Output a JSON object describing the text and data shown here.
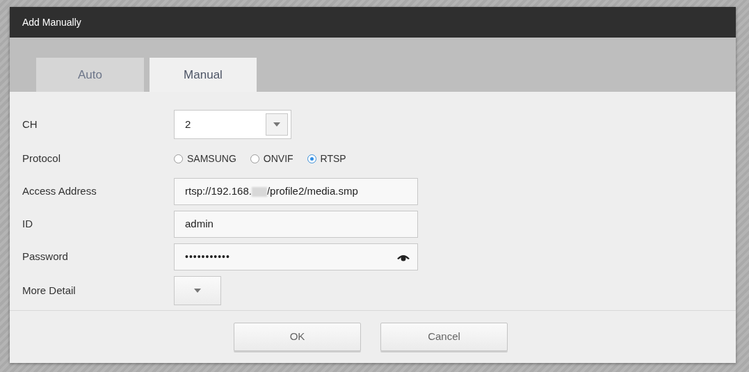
{
  "window": {
    "title": "Add Manually"
  },
  "tabs": [
    {
      "label": "Auto",
      "selected": false
    },
    {
      "label": "Manual",
      "selected": true
    }
  ],
  "form": {
    "ch": {
      "label": "CH",
      "value": "2"
    },
    "protocol": {
      "label": "Protocol",
      "options": [
        {
          "label": "SAMSUNG",
          "selected": false
        },
        {
          "label": "ONVIF",
          "selected": false
        },
        {
          "label": "RTSP",
          "selected": true
        }
      ]
    },
    "access_address": {
      "label": "Access Address",
      "value_before": "rtsp://192.168.",
      "redacted": true,
      "value_after": "/profile2/media.smp"
    },
    "id": {
      "label": "ID",
      "value": "admin"
    },
    "password": {
      "label": "Password",
      "value": "•••••••••••"
    },
    "more_detail": {
      "label": "More Detail"
    }
  },
  "buttons": [
    "OK",
    "Cancel"
  ]
}
